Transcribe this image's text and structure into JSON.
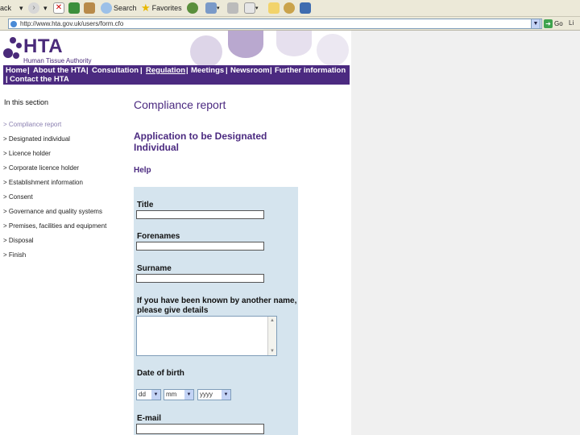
{
  "browser": {
    "toolbar": {
      "cut_label": "ack",
      "search_label": "Search",
      "favorites_label": "Favorites"
    },
    "address": "http://www.hta.gov.uk/users/form.cfo",
    "go_label": "Go",
    "links_label": "Li"
  },
  "site": {
    "logo_text": "HTA",
    "logo_sub": "Human Tissue Authority"
  },
  "nav": {
    "row1": [
      "Home",
      "About the HTA",
      "Consultation",
      "Regulation",
      "Meetings",
      "Newsroom",
      "Further information"
    ],
    "separator": " | ",
    "row2_prefix": "| ",
    "row2": "Contact the HTA"
  },
  "sidebar": {
    "heading": "In this section",
    "items": [
      "> Compliance report",
      "> Designated individual",
      "> Licence holder",
      "> Corporate licence holder",
      "> Establishment information",
      "> Consent",
      "> Governance and quality systems",
      "> Premises, facilities and equipment",
      "> Disposal",
      "> Finish"
    ]
  },
  "main": {
    "heading": "Compliance report",
    "form_title": "Application to be Designated Individual",
    "help": "Help",
    "fields": {
      "title": "Title",
      "forenames": "Forenames",
      "surname": "Surname",
      "known_by": "If you have been known by another name, please give details",
      "dob": "Date of birth",
      "email": "E-mail"
    },
    "dob": {
      "day": "dd",
      "month": "mm",
      "year": "yyyy"
    }
  },
  "colors": {
    "brand_purple": "#4b2a80",
    "form_bg": "#d5e4ee",
    "chrome": "#ece9d8"
  }
}
